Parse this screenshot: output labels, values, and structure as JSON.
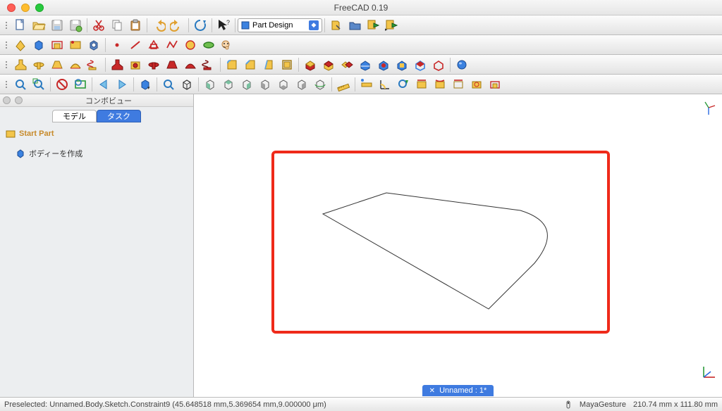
{
  "title": "FreeCAD 0.19",
  "workbench_selector": {
    "label": "Part Design"
  },
  "panel": {
    "title": "コンボビュー",
    "tabs": [
      {
        "label": "モデル",
        "active": false
      },
      {
        "label": "タスク",
        "active": true
      }
    ],
    "tree": {
      "root": "Start Part",
      "child": "ボディーを作成"
    }
  },
  "document_tab": "Unnamed : 1*",
  "status": {
    "preselect": "Preselected: Unnamed.Body.Sketch.Constraint9 (45.648518 mm,5.369654 mm,9.000000 μm)",
    "nav_style": "MayaGesture",
    "dims": "210.74 mm x 111.80 mm"
  },
  "toolbar_rows": {
    "row1_icons": [
      "new-file",
      "open-file",
      "save-file",
      "save-as",
      "cut",
      "copy",
      "paste",
      "undo",
      "redo",
      "refresh",
      "whats-this",
      "workbench-select",
      "macro-record",
      "macro-open",
      "macro-run",
      "macro-run-2"
    ],
    "row2_icons": [
      "create-datum",
      "create-plane",
      "create-line",
      "create-coord",
      "create-shapebinder",
      "create-point",
      "sketch-line",
      "sketch-rect",
      "sketch-poly",
      "sketch-circle",
      "sketch-ellipse",
      "sketch-char"
    ],
    "row3_icons": [
      "pad",
      "revolution",
      "loft",
      "sweep",
      "helix",
      "pocket",
      "hole",
      "groove",
      "sub-loft",
      "sub-sweep",
      "sub-helix",
      "fillet",
      "chamfer",
      "draft",
      "thickness",
      "boolean-cut",
      "boolean-fuse",
      "boolean-common",
      "mirror",
      "linear-pattern",
      "polar-pattern",
      "multi-transform",
      "scaled",
      "shape-color",
      "appearance",
      "sphere-vis"
    ],
    "row4_icons": [
      "fit-all",
      "fit-selection",
      "isometric",
      "front-view",
      "nav-left",
      "nav-right",
      "draw-style",
      "zoom",
      "view-iso",
      "box-1",
      "box-2",
      "box-3",
      "box-4",
      "box-5",
      "box-6",
      "box-7",
      "measure",
      "measure-dist",
      "toggle-1",
      "toggle-2",
      "toggle-3",
      "toggle-4",
      "toggle-5",
      "toggle-6",
      "toggle-7"
    ]
  },
  "colors": {
    "accent": "#3f7be0",
    "highlight": "#ef2a1a"
  }
}
